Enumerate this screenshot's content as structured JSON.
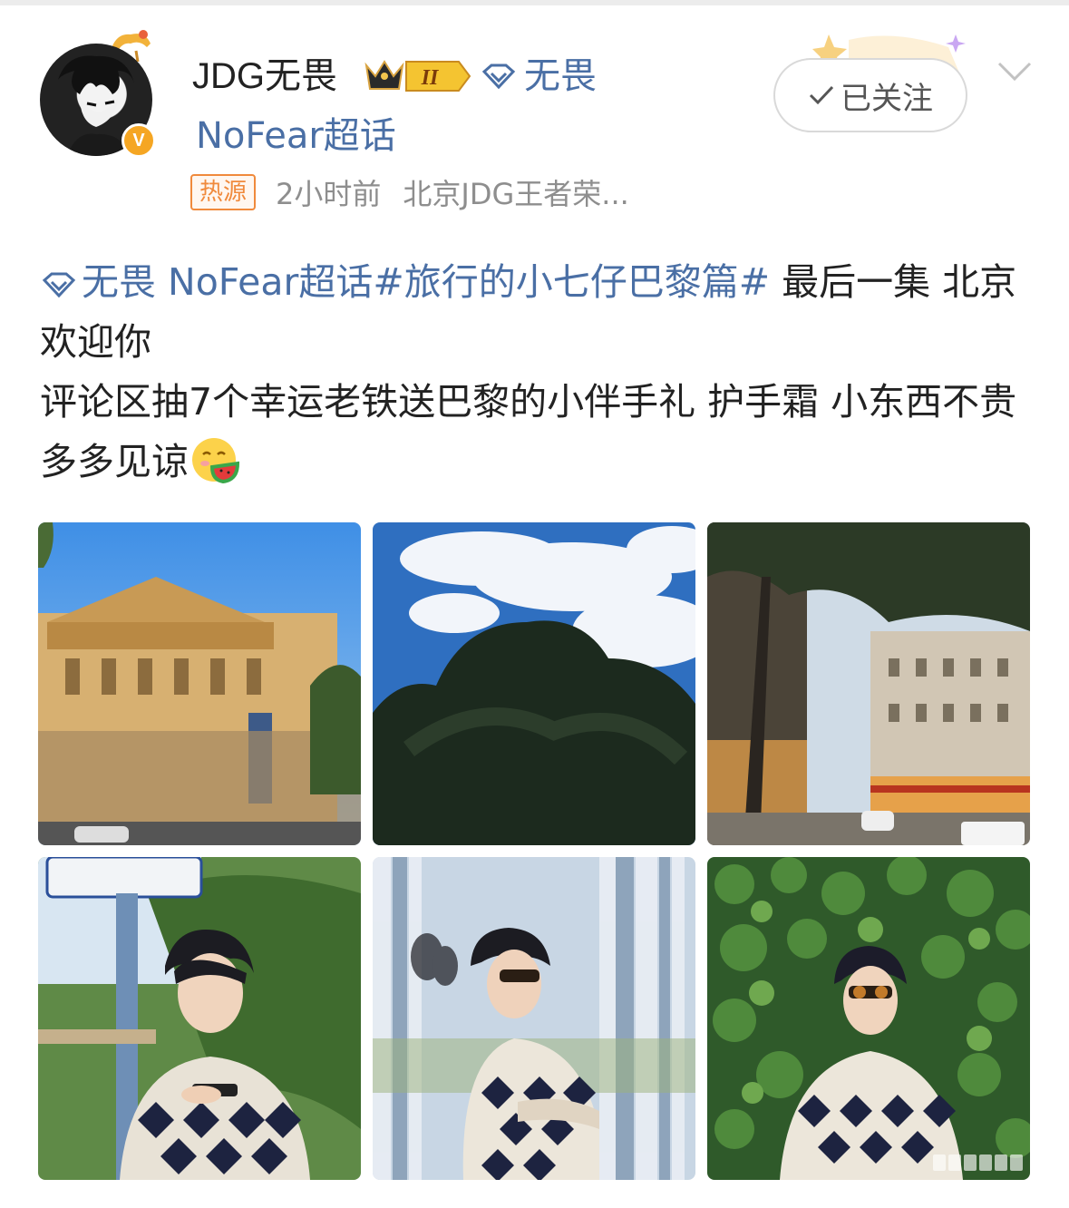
{
  "post": {
    "author": {
      "name": "JDG无畏",
      "vip_level": "II",
      "super_topic_label": "无畏",
      "topic_link": "NoFear超话",
      "verified": "V"
    },
    "meta": {
      "tag": "热源",
      "time": "2小时前",
      "source": "北京JDG王者荣..."
    },
    "follow_button": {
      "label": "已关注",
      "check_icon": "check-icon"
    },
    "content": {
      "topic_prefix": "无畏 NoFear超话",
      "hashtag": "#旅行的小七仔巴黎篇#",
      "line1_rest": " 最后一集 北京欢迎你",
      "line2": "评论区抽7个幸运老铁送巴黎的小伴手礼 护手霜 小东西不贵 多多见谅",
      "emoji": "eating-watermelon-emoji"
    },
    "photos": [
      {
        "name": "photo-opera-house",
        "subject": "opera-building"
      },
      {
        "name": "photo-sky-tree",
        "subject": "clouds-and-tree"
      },
      {
        "name": "photo-paris-street",
        "subject": "street-at-dusk"
      },
      {
        "name": "photo-portrait-sign",
        "subject": "portrait-by-sign"
      },
      {
        "name": "photo-portrait-mirrors",
        "subject": "portrait-mirrors"
      },
      {
        "name": "photo-portrait-ivy",
        "subject": "portrait-ivy-wall"
      }
    ]
  },
  "colors": {
    "link": "#4a6fa5",
    "hot_tag": "#f08a3c",
    "meta": "#8e8e8e",
    "verify": "#f5a623"
  }
}
